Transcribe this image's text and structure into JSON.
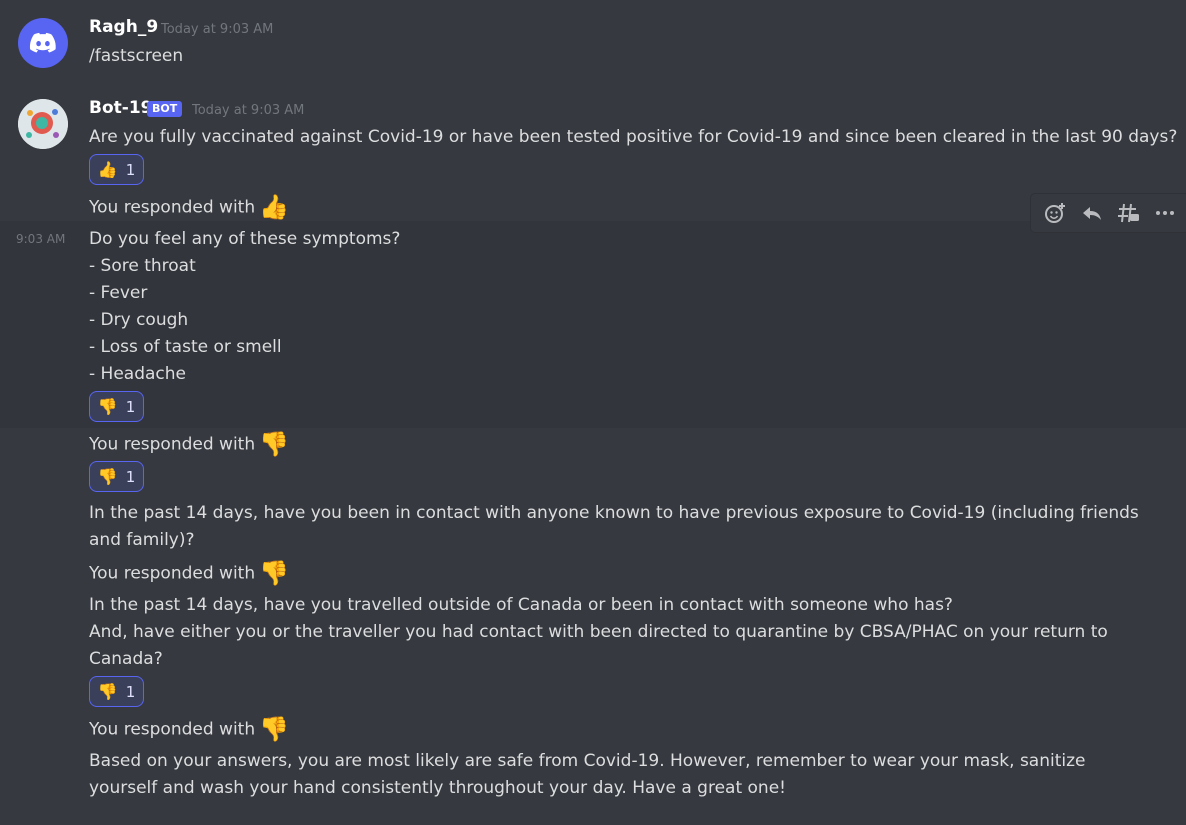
{
  "messages": {
    "user": {
      "author": "Ragh_9",
      "timestamp": "Today at 9:03 AM",
      "text": "/fastscreen"
    },
    "bot": {
      "author": "Bot-19",
      "tag": "BOT",
      "timestamp": "Today at 9:03 AM",
      "side_timestamp": "9:03 AM",
      "q1": "Are you fully vaccinated against Covid-19 or have been tested positive for Covid-19 and since been cleared in the last 90 days?",
      "responded_label": "You responded with",
      "q2_lines": [
        "Do you feel any of these symptoms?",
        "- Sore throat",
        "- Fever",
        "- Dry cough",
        "- Loss of taste or smell",
        "- Headache"
      ],
      "q3": "In the past 14 days, have you been in contact with anyone known to have previous exposure to Covid-19 (including friends and family)?",
      "q4_line1": "In the past 14 days, have you travelled outside  of Canada or been in contact with someone who has?",
      "q4_line2": "And, have either you or the traveller you had contact with been directed to quarantine by CBSA/PHAC on your return to Canada?",
      "final": "Based on your answers, you are most likely are safe from Covid-19. However, remember to wear your mask, sanitize yourself and wash your hand consistently throughout your day. Have a great one!"
    }
  },
  "reactions": [
    {
      "emoji": "👍",
      "count": "1"
    },
    {
      "emoji": "👎",
      "count": "1"
    },
    {
      "emoji": "👎",
      "count": "1"
    },
    {
      "emoji": "👎",
      "count": "1"
    }
  ],
  "responses": {
    "thumbs_up": "👍",
    "thumbs_down": "👎"
  },
  "toolbar": {
    "icons": [
      "add-reaction-icon",
      "reply-icon",
      "create-thread-icon",
      "more-icon"
    ]
  },
  "colors": {
    "accent": "#5865f2",
    "background": "#36393f",
    "hover": "#32353b"
  }
}
